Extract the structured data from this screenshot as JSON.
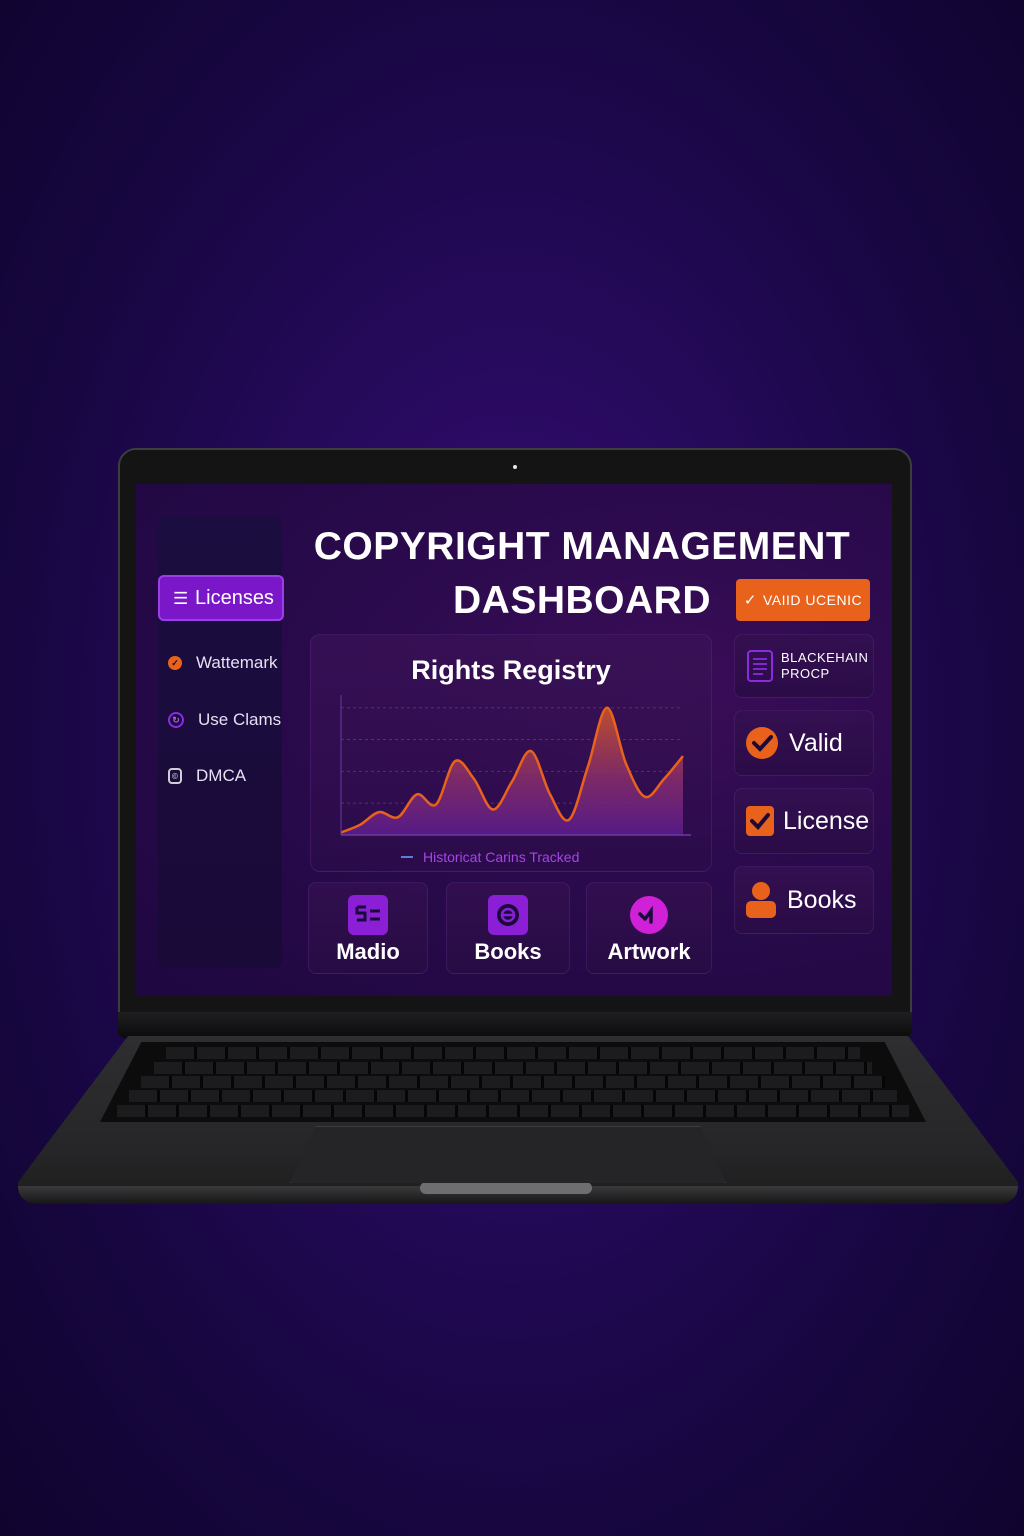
{
  "dashboard": {
    "title_line1": "COPYRIGHT MANAGEMENT",
    "title_line2": "DASHBOARD"
  },
  "sidebar": {
    "items": [
      {
        "label": "Licenses",
        "icon": "list-icon",
        "active": true
      },
      {
        "label": "Wattemark",
        "icon": "check-circle-icon",
        "color": "#e9621b"
      },
      {
        "label": "Use Clams",
        "icon": "refresh-icon",
        "color": "#8a2be2"
      },
      {
        "label": "DMCA",
        "icon": "copyright-icon",
        "color": "#cfcfd8"
      }
    ]
  },
  "chart": {
    "title": "Rights Registry",
    "legend": "Historicat Carins Tracked"
  },
  "chart_data": {
    "type": "area",
    "title": "Rights Registry",
    "series": [
      {
        "name": "Historicat Carins Tracked",
        "values": [
          2,
          8,
          18,
          14,
          32,
          24,
          58,
          44,
          20,
          42,
          66,
          32,
          12,
          54,
          100,
          56,
          30,
          44,
          62
        ]
      }
    ],
    "ylim": [
      0,
      110
    ],
    "grid": true,
    "colors": {
      "line": "#e9621b",
      "fill_top": "#b44a3a",
      "fill_bottom": "#5c1c8a"
    }
  },
  "tiles": [
    {
      "label": "Madio",
      "icon": "media-icon",
      "color": "#8a1fd6"
    },
    {
      "label": "Books",
      "icon": "book-icon",
      "color": "#8a1fd6"
    },
    {
      "label": "Artwork",
      "icon": "artwork-icon",
      "color": "#d020d8"
    }
  ],
  "right_panel": {
    "valid_button": "VAIID UCENIC",
    "blockchain_line1": "BLACKEHAIN",
    "blockchain_line2": "PROCP",
    "valid_label": "Valid",
    "license_label": "License",
    "books_label": "Books"
  },
  "colors": {
    "accent_purple": "#7a17c9",
    "accent_orange": "#e9621b"
  }
}
